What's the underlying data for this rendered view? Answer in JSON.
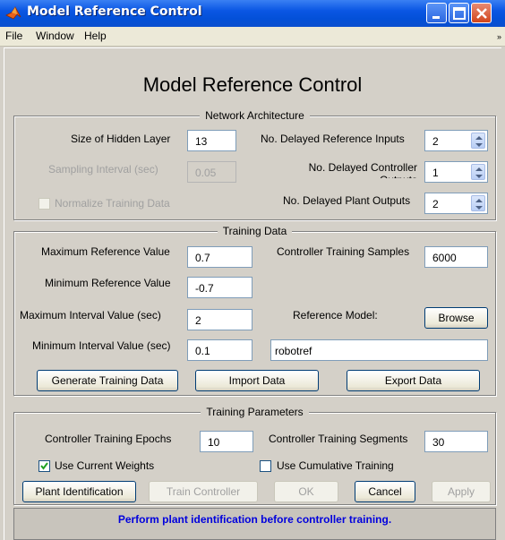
{
  "window": {
    "title": "Model Reference Control"
  },
  "menu": {
    "items": [
      "File",
      "Window",
      "Help"
    ],
    "overflow_glyph": "»"
  },
  "page_title": "Model Reference Control",
  "network_architecture": {
    "title": "Network Architecture",
    "hidden_layer_label": "Size of Hidden Layer",
    "hidden_layer_value": "13",
    "sampling_interval_label": "Sampling Interval (sec)",
    "sampling_interval_value": "0.05",
    "normalize_label": "Normalize Training Data",
    "normalize_checked": false,
    "delayed_ref_inputs_label": "No. Delayed Reference Inputs",
    "delayed_ref_inputs_value": "2",
    "delayed_ctrl_outputs_label": "No. Delayed Controller Outputs",
    "delayed_ctrl_outputs_value": "1",
    "delayed_plant_outputs_label": "No. Delayed Plant Outputs",
    "delayed_plant_outputs_value": "2"
  },
  "training_data": {
    "title": "Training Data",
    "max_ref_label": "Maximum Reference Value",
    "max_ref_value": "0.7",
    "min_ref_label": "Minimum Reference Value",
    "min_ref_value": "-0.7",
    "max_interval_label": "Maximum Interval Value (sec)",
    "max_interval_value": "2",
    "min_interval_label": "Minimum Interval Value (sec)",
    "min_interval_value": "0.1",
    "samples_label": "Controller Training Samples",
    "samples_value": "6000",
    "ref_model_label": "Reference Model:",
    "browse_label": "Browse",
    "ref_model_value": "robotref",
    "generate_label": "Generate Training Data",
    "import_label": "Import Data",
    "export_label": "Export Data"
  },
  "training_parameters": {
    "title": "Training Parameters",
    "epochs_label": "Controller Training Epochs",
    "epochs_value": "10",
    "segments_label": "Controller Training Segments",
    "segments_value": "30",
    "current_weights_label": "Use Current Weights",
    "current_weights_checked": true,
    "cumulative_label": "Use Cumulative Training",
    "cumulative_checked": false,
    "plant_id_label": "Plant Identification",
    "train_label": "Train Controller",
    "ok_label": "OK",
    "cancel_label": "Cancel",
    "apply_label": "Apply"
  },
  "status": {
    "message": "Perform plant identification before controller training."
  },
  "colors": {
    "titlebar": "#0a56e3",
    "status_text": "#0000dd"
  }
}
